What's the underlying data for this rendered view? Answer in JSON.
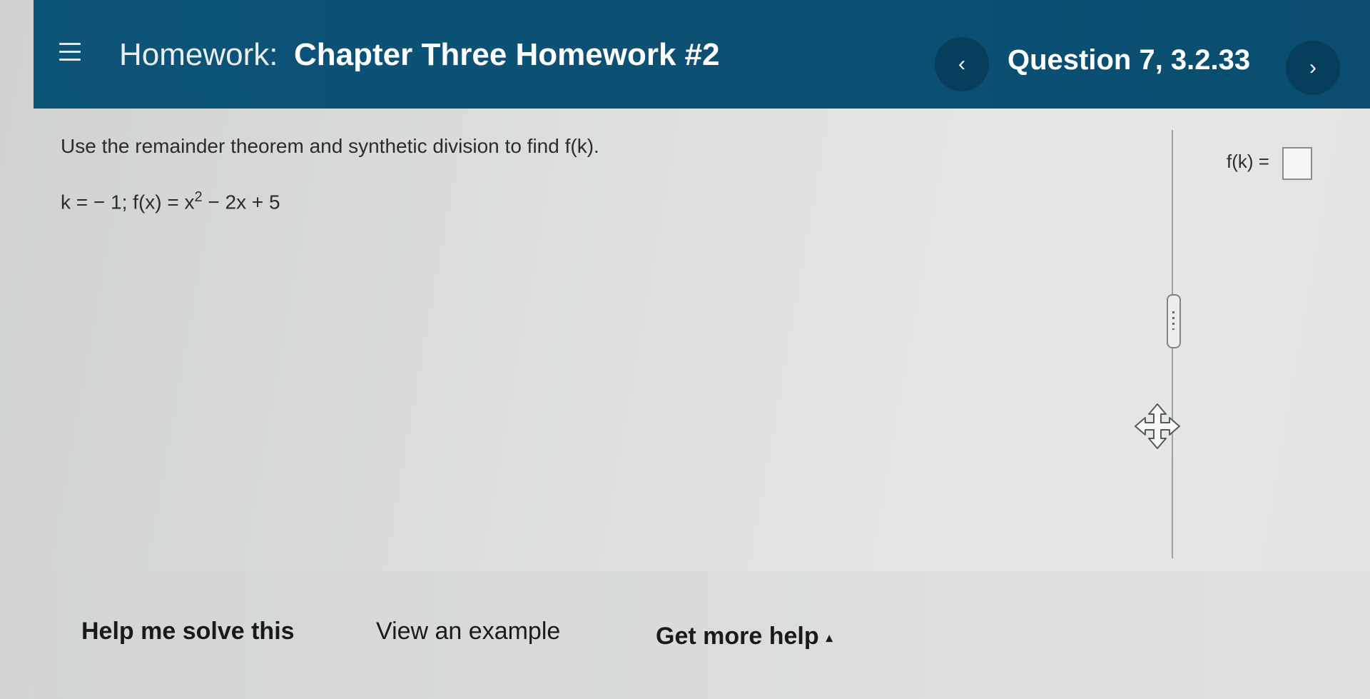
{
  "header": {
    "menu_icon": "hamburger-menu-icon",
    "homework_label": "Homework:",
    "homework_title": "Chapter Three Homework #2",
    "prev_glyph": "‹",
    "question_label": "Question 7, 3.2.33",
    "next_glyph": "›"
  },
  "question": {
    "instruction": "Use the remainder theorem and synthetic division to find f(k).",
    "given_prefix": "k = − 1; f(x) = x",
    "given_exponent": "2",
    "given_suffix": " − 2x + 5"
  },
  "answer": {
    "label": "f(k) =",
    "value": ""
  },
  "footer": {
    "help_label": "Help me solve this",
    "example_label": "View an example",
    "more_help_label": "Get more help",
    "more_help_caret": "▴"
  },
  "colors": {
    "header_bg": "#0d5479",
    "nav_button_bg": "#063e5b",
    "page_bg": "#dcdfde"
  }
}
